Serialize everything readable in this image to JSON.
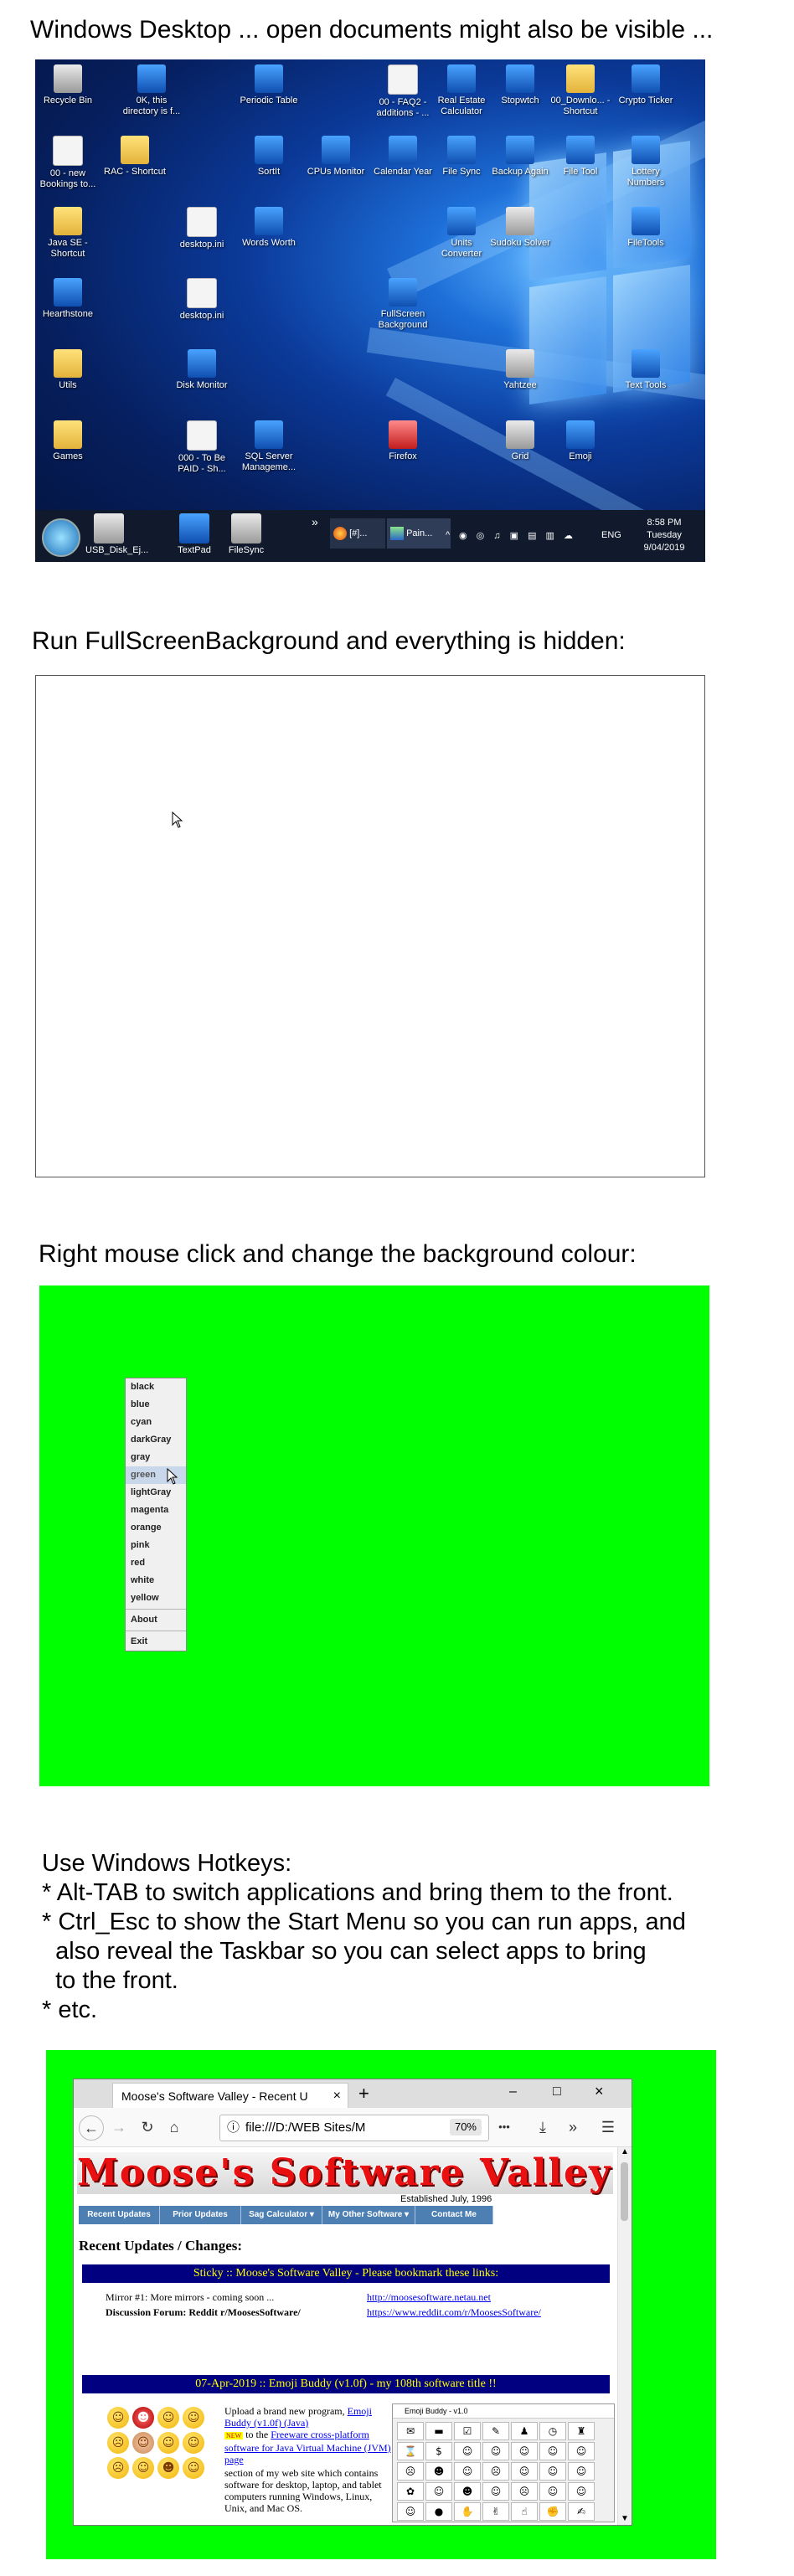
{
  "headings": {
    "section1": "Windows Desktop  ... open documents might also be visible ...",
    "section2": "Run FullScreenBackground and everything is hidden:",
    "section3": "Right mouse click and change the background colour:"
  },
  "desktop": {
    "icons": [
      {
        "label": "Recycle Bin",
        "icon": "recycle-bin-icon"
      },
      {
        "label": "0K, this directory is f...",
        "icon": "app-icon"
      },
      {
        "label": "Periodic Table",
        "icon": "periodic-table-icon"
      },
      {
        "label": "00 - FAQ2 - additions - ...",
        "icon": "document-icon"
      },
      {
        "label": "Real Estate Calculator",
        "icon": "calculator-icon"
      },
      {
        "label": "Stopwtch",
        "icon": "stopwatch-icon"
      },
      {
        "label": "00_Downlo... - Shortcut",
        "icon": "folder-icon"
      },
      {
        "label": "Crypto Ticker",
        "icon": "app-icon"
      },
      {
        "label": "00 - new Bookings to...",
        "icon": "document-icon"
      },
      {
        "label": "RAC - Shortcut",
        "icon": "folder-icon"
      },
      {
        "label": "SortIt",
        "icon": "app-icon"
      },
      {
        "label": "CPUs Monitor",
        "icon": "monitor-icon"
      },
      {
        "label": "Calendar Year",
        "icon": "calendar-icon"
      },
      {
        "label": "File Sync",
        "icon": "sync-icon"
      },
      {
        "label": "Backup Again",
        "icon": "backup-icon"
      },
      {
        "label": "File Tool",
        "icon": "tool-icon"
      },
      {
        "label": "Lottery Numbers",
        "icon": "app-icon"
      },
      {
        "label": "Java SE - Shortcut",
        "icon": "folder-icon"
      },
      {
        "label": "desktop.ini",
        "icon": "file-icon"
      },
      {
        "label": "Words Worth",
        "icon": "words-icon"
      },
      {
        "label": "Units Converter",
        "icon": "app-icon"
      },
      {
        "label": "Sudoku Solver",
        "icon": "grid-icon"
      },
      {
        "label": "FileTools",
        "icon": "app-icon"
      },
      {
        "label": "Hearthstone",
        "icon": "game-icon"
      },
      {
        "label": "desktop.ini",
        "icon": "file-icon"
      },
      {
        "label": "FullScreen Background",
        "icon": "app-icon"
      },
      {
        "label": "Utils",
        "icon": "folder-icon"
      },
      {
        "label": "Disk Monitor",
        "icon": "disk-icon"
      },
      {
        "label": "Yahtzee",
        "icon": "dice-icon"
      },
      {
        "label": "Text Tools",
        "icon": "app-icon"
      },
      {
        "label": "Games",
        "icon": "folder-icon"
      },
      {
        "label": "000 - To Be PAID - Sh...",
        "icon": "document-icon"
      },
      {
        "label": "SQL Server Manageme...",
        "icon": "database-icon"
      },
      {
        "label": "Firefox",
        "icon": "firefox-icon"
      },
      {
        "label": "Grid",
        "icon": "grid-icon"
      },
      {
        "label": "Emoji",
        "icon": "emoji-icon"
      }
    ],
    "taskbar": {
      "pinned": [
        "USB_Disk_Ej...",
        "TextPad",
        "FileSync"
      ],
      "windows": [
        "[#]...",
        "Pain..."
      ],
      "chevron": "»",
      "tray_text": "ENG",
      "time": "8:58 PM",
      "day": "Tuesday",
      "date": "9/04/2019"
    }
  },
  "context_menu": {
    "items": [
      "black",
      "blue",
      "cyan",
      "darkGray",
      "gray",
      "green",
      "lightGray",
      "magenta",
      "orange",
      "pink",
      "red",
      "white",
      "yellow"
    ],
    "selected": "green",
    "extra": [
      "About",
      "Exit"
    ],
    "bg_color": "#00ff00"
  },
  "hotkeys": {
    "lines": [
      "Use Windows Hotkeys:",
      "* Alt-TAB to switch applications and bring them to the front.",
      "* Ctrl_Esc to show the Start Menu so you can run apps, and",
      "  also reveal the Taskbar so you can select apps to bring",
      "  to the front.",
      "* etc."
    ]
  },
  "browser": {
    "tab_title": "Moose's Software Valley - Recent U",
    "tab_close": "×",
    "new_tab": "+",
    "win_min": "–",
    "win_max": "□",
    "win_close": "×",
    "url": "file:///D:/WEB Sites/M",
    "zoom": "70%",
    "dots": "•••",
    "site_title": "Moose's Software Valley",
    "established": "Established July, 1996",
    "menu": [
      "Recent Updates",
      "Prior Updates",
      "Sag Calculator ▾",
      "My Other Software ▾",
      "Contact Me"
    ],
    "section_title": "Recent Updates / Changes:",
    "sticky": "Sticky :: Moose's Software Valley - Please bookmark these links:",
    "mirror_label": "Mirror #1: More mirrors - coming soon ...",
    "mirror_url": "http://moosesoftware.netau.net",
    "forum_label": "Discussion Forum: Reddit r/MoosesSoftware/",
    "forum_url": "https://www.reddit.com/r/MoosesSoftware/",
    "update_band": "07-Apr-2019 :: Emoji Buddy (v1.0f) - my 108th software title !!",
    "upload_text_1": "Upload a brand new program,",
    "upload_link_1": "Emoji Buddy (v1.0f) (Java)",
    "new_badge": "NEW",
    "upload_text_2": "to the",
    "upload_link_2": "Freeware cross-platform software for Java Virtual Machine (JVM) page",
    "upload_text_3": "section of my web site which contains software for desktop, laptop, and tablet computers running Windows, Linux, Unix, and Mac OS.",
    "emoji_window_title": "Emoji Buddy - v1.0",
    "accent": "#000080",
    "band_text_color": "#ffff00"
  }
}
